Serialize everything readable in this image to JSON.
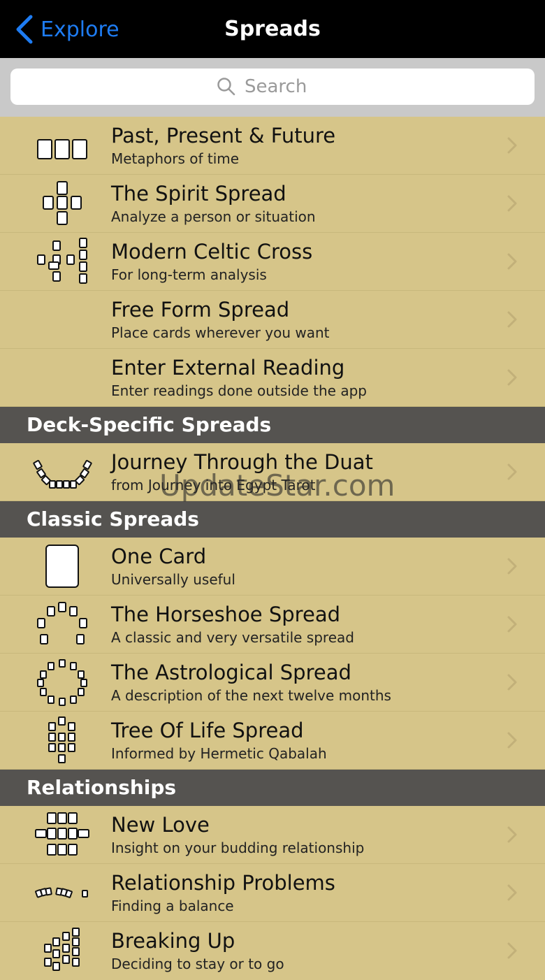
{
  "nav": {
    "back_label": "Explore",
    "title": "Spreads"
  },
  "search": {
    "placeholder": "Search"
  },
  "sections": [
    {
      "header": "",
      "rows": [
        {
          "title": "Past, Present & Future",
          "subtitle": "Metaphors of time",
          "icon": "three-cards-icon"
        },
        {
          "title": "The Spirit Spread",
          "subtitle": "Analyze a person or situation",
          "icon": "cross-cards-icon"
        },
        {
          "title": "Modern Celtic Cross",
          "subtitle": "For long-term analysis",
          "icon": "celtic-cross-icon"
        },
        {
          "title": "Free Form Spread",
          "subtitle": "Place cards wherever you want",
          "icon": ""
        },
        {
          "title": "Enter External Reading",
          "subtitle": "Enter readings done outside the app",
          "icon": ""
        }
      ]
    },
    {
      "header": "Deck-Specific Spreads",
      "rows": [
        {
          "title": "Journey Through the Duat",
          "subtitle": "from Journey into Egypt Tarot",
          "icon": "duat-boat-icon"
        }
      ]
    },
    {
      "header": "Classic Spreads",
      "rows": [
        {
          "title": "One Card",
          "subtitle": "Universally useful",
          "icon": "single-card-icon"
        },
        {
          "title": "The Horseshoe Spread",
          "subtitle": "A classic and very versatile spread",
          "icon": "horseshoe-icon"
        },
        {
          "title": "The Astrological Spread",
          "subtitle": "A description of the next twelve months",
          "icon": "astrological-circle-icon"
        },
        {
          "title": "Tree Of Life Spread",
          "subtitle": "Informed by Hermetic Qabalah",
          "icon": "tree-of-life-icon"
        }
      ]
    },
    {
      "header": "Relationships",
      "rows": [
        {
          "title": "New Love",
          "subtitle": "Insight on your budding relationship",
          "icon": "new-love-grid-icon"
        },
        {
          "title": "Relationship Problems",
          "subtitle": "Finding a balance",
          "icon": "relationship-row-icon"
        },
        {
          "title": "Breaking Up",
          "subtitle": "Deciding to stay or to go",
          "icon": "breaking-up-icon"
        }
      ]
    }
  ],
  "watermark": "UpdateStar.com",
  "colors": {
    "navbar": "#000000",
    "accent": "#1e7cf2",
    "list_background": "#d6c589",
    "section_header": "#555350",
    "search_bar": "#c9c9c9"
  }
}
